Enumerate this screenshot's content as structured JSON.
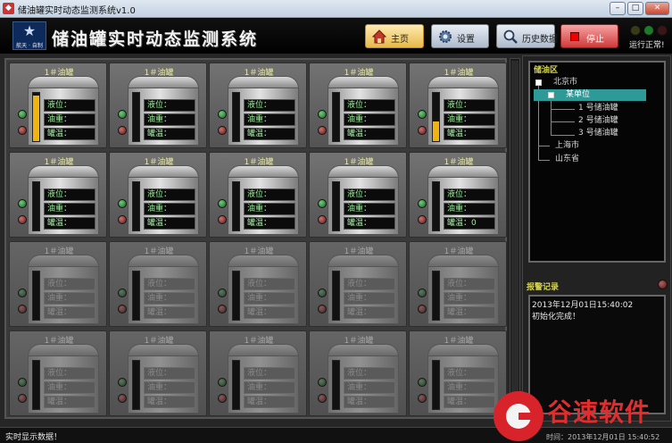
{
  "window": {
    "title": "储油罐实时动态监测系统v1.0",
    "controls": {
      "minimize": "–",
      "maximize": "□",
      "close": "✕"
    }
  },
  "header": {
    "logo_text": "航天 · 自制",
    "title": "储油罐实时动态监测系统",
    "buttons": {
      "home": "主页",
      "settings": "设置",
      "history": "历史数据",
      "stop": "停止"
    },
    "status_text": "运行正常!",
    "lamp_colors": [
      "#3a3a16",
      "#1d7a2a",
      "#3a1616"
    ]
  },
  "tanks": [
    {
      "name": "1＃油罐",
      "active": true,
      "level_fraction": 0.95,
      "labels": [
        "液位：",
        "油重：",
        "罐温："
      ]
    },
    {
      "name": "1＃油罐",
      "active": true,
      "level_fraction": 0.0,
      "labels": [
        "液位：",
        "油重：",
        "罐温："
      ]
    },
    {
      "name": "1＃油罐",
      "active": true,
      "level_fraction": 0.0,
      "labels": [
        "液位：",
        "油重：",
        "罐温："
      ]
    },
    {
      "name": "1＃油罐",
      "active": true,
      "level_fraction": 0.0,
      "labels": [
        "液位：",
        "油重：",
        "罐温："
      ]
    },
    {
      "name": "1＃油罐",
      "active": true,
      "level_fraction": 0.4,
      "labels": [
        "液位：",
        "油重：",
        "罐温："
      ]
    },
    {
      "name": "1＃油罐",
      "active": true,
      "level_fraction": 0.0,
      "labels": [
        "液位：",
        "油重：",
        "罐温："
      ]
    },
    {
      "name": "1＃油罐",
      "active": true,
      "level_fraction": 0.0,
      "labels": [
        "液位：",
        "油重：",
        "罐温："
      ]
    },
    {
      "name": "1＃油罐",
      "active": true,
      "level_fraction": 0.0,
      "labels": [
        "液位：",
        "油重：",
        "罐温："
      ]
    },
    {
      "name": "1＃油罐",
      "active": true,
      "level_fraction": 0.0,
      "labels": [
        "液位：",
        "油重：",
        "罐温："
      ]
    },
    {
      "name": "1＃油罐",
      "active": true,
      "level_fraction": 0.0,
      "labels": [
        "液位：",
        "油重：",
        "罐温：0"
      ]
    },
    {
      "name": "1＃油罐",
      "active": false,
      "level_fraction": 0.0,
      "labels": [
        "液位：",
        "油重：",
        "罐温："
      ]
    },
    {
      "name": "1＃油罐",
      "active": false,
      "level_fraction": 0.0,
      "labels": [
        "液位：",
        "油重：",
        "罐温："
      ]
    },
    {
      "name": "1＃油罐",
      "active": false,
      "level_fraction": 0.0,
      "labels": [
        "液位：",
        "油重：",
        "罐温："
      ]
    },
    {
      "name": "1＃油罐",
      "active": false,
      "level_fraction": 0.0,
      "labels": [
        "液位：",
        "油重：",
        "罐温："
      ]
    },
    {
      "name": "1＃油罐",
      "active": false,
      "level_fraction": 0.0,
      "labels": [
        "液位：",
        "油重：",
        "罐温："
      ]
    },
    {
      "name": "1＃油罐",
      "active": false,
      "level_fraction": 0.0,
      "labels": [
        "液位：",
        "油重：",
        "罐温："
      ]
    },
    {
      "name": "1＃油罐",
      "active": false,
      "level_fraction": 0.0,
      "labels": [
        "液位：",
        "油重：",
        "罐温："
      ]
    },
    {
      "name": "1＃油罐",
      "active": false,
      "level_fraction": 0.0,
      "labels": [
        "液位：",
        "油重：",
        "罐温："
      ]
    },
    {
      "name": "1＃油罐",
      "active": false,
      "level_fraction": 0.0,
      "labels": [
        "液位：",
        "油重：",
        "罐温："
      ]
    },
    {
      "name": "1＃油罐",
      "active": false,
      "level_fraction": 0.0,
      "labels": [
        "液位：",
        "油重：",
        "罐温："
      ]
    }
  ],
  "tree": {
    "title": "储油区",
    "nodes": {
      "beijing": "北京市",
      "unit": "某单位",
      "tank1": "1 号储油罐",
      "tank2": "2 号储油罐",
      "tank3": "3 号储油罐",
      "shanghai": "上海市",
      "shandong": "山东省"
    }
  },
  "alarm": {
    "title": "报警记录",
    "lines": [
      "2013年12月01日15:40:02",
      "初始化完成！"
    ]
  },
  "statusbar": {
    "text": "实时显示数据！",
    "time": "时间：2013年12月01日 15:40:52"
  },
  "watermark": {
    "text": "谷速软件"
  }
}
